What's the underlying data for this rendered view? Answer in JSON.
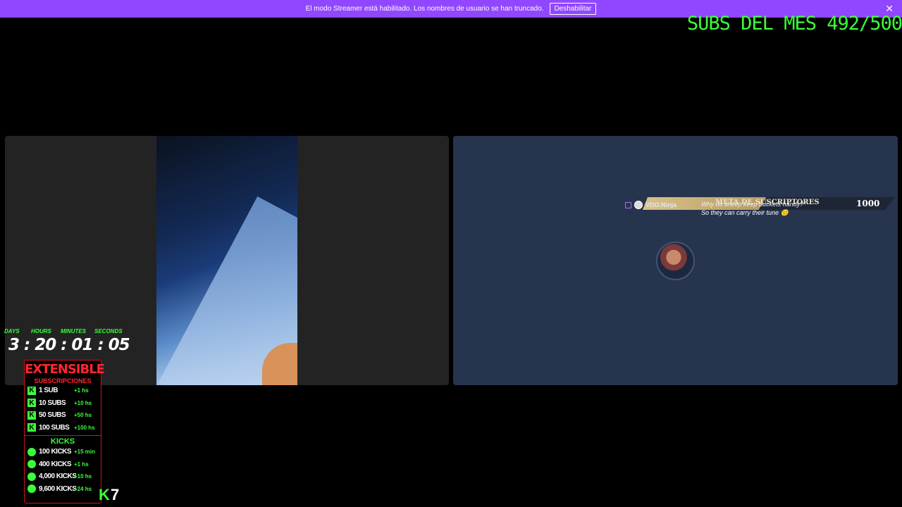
{
  "banner": {
    "message": "El modo Streamer está habilitado. Los nombres de usuario se han truncado.",
    "button_label": "Deshabilitar",
    "close_glyph": "✕"
  },
  "overlay": {
    "subs_month": "SUBS DEL MES 492/500"
  },
  "goal_ribbon": {
    "title": "META DE SUSCRIPTORES",
    "target": "1000"
  },
  "chat": {
    "platform_icon": "twitch-icon",
    "username": "VDO.Ninja",
    "message_line1": "Why do sheep keep buckets handy?",
    "message_line2": "So they can carry their tune 🙂"
  },
  "timer": {
    "labels": [
      "DAYS",
      "HOURS",
      "MINUTES",
      "SECONDS"
    ],
    "value": "3 : 20 : 01 : 05"
  },
  "extensible": {
    "title": "EXTENSIBLE",
    "subs_heading": "SUBSCRIPCIONES",
    "subs": [
      {
        "name": "1 SUB",
        "bonus": "+1 hs"
      },
      {
        "name": "10 SUBS",
        "bonus": "+10 hs"
      },
      {
        "name": "50 SUBS",
        "bonus": "+50 hs"
      },
      {
        "name": "100 SUBS",
        "bonus": "+100 hs"
      }
    ],
    "kicks_heading": "KICKS",
    "kicks": [
      {
        "name": "100 KICKS",
        "bonus": "+15 min"
      },
      {
        "name": "400 KICKS",
        "bonus": "+1 hs"
      },
      {
        "name": "4,000 KICKS",
        "bonus": "+10 hs"
      },
      {
        "name": "9,600 KICKS",
        "bonus": "+24 hs"
      }
    ]
  },
  "corner": {
    "number": "7"
  },
  "colors": {
    "banner": "#9147ff",
    "accent_green": "#3bff3b",
    "accent_red": "#ff2630",
    "right_panel": "#27344e"
  }
}
